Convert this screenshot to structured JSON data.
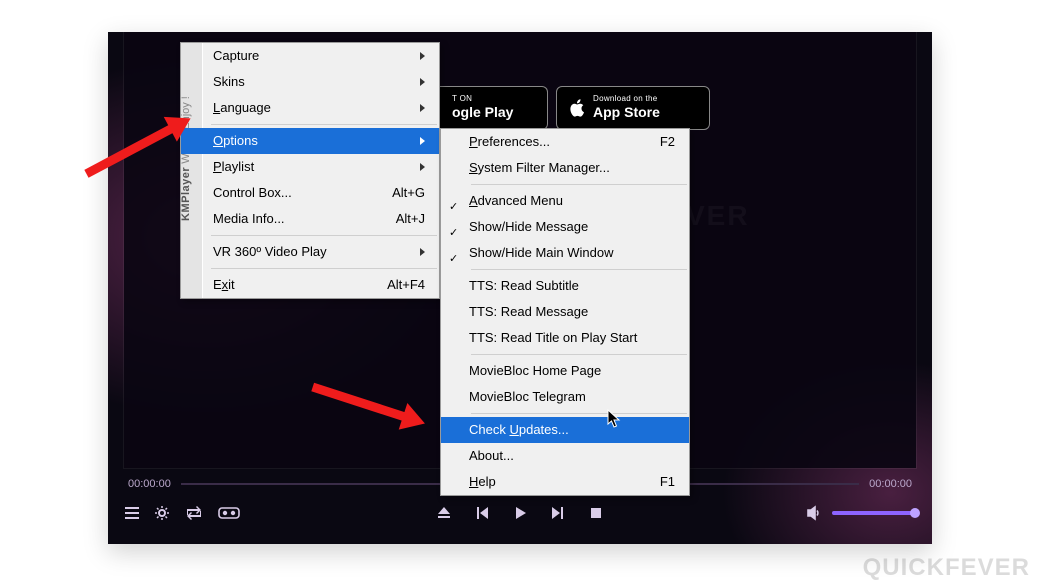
{
  "app": {
    "brand": "KMPlayer",
    "tagline": "We All Enjoy !",
    "watermark": "QUICKFEVER"
  },
  "store": {
    "google": {
      "small": "T ON",
      "big": "ogle Play"
    },
    "apple": {
      "small": "Download on the",
      "big": "App Store"
    }
  },
  "time": {
    "left": "00:00:00",
    "right": "00:00:00"
  },
  "menu1": {
    "items": [
      {
        "label": "Capture",
        "submenu": true
      },
      {
        "label": "Skins",
        "submenu": true
      },
      {
        "label": "Language",
        "submenu": true,
        "ul": 0
      },
      {
        "sep": true
      },
      {
        "label": "Options",
        "submenu": true,
        "ul": 0,
        "highlight": true
      },
      {
        "label": "Playlist",
        "submenu": true,
        "ul": 0
      },
      {
        "label": "Control Box...",
        "shortcut": "Alt+G"
      },
      {
        "label": "Media Info...",
        "shortcut": "Alt+J"
      },
      {
        "sep": true
      },
      {
        "label": "VR 360º Video Play",
        "submenu": true
      },
      {
        "sep": true
      },
      {
        "label": "Exit",
        "shortcut": "Alt+F4",
        "ul": 1
      }
    ]
  },
  "menu2": {
    "items": [
      {
        "label": "Preferences...",
        "shortcut": "F2",
        "ul": 0
      },
      {
        "label": "System Filter Manager...",
        "ul": 0
      },
      {
        "sep": true
      },
      {
        "label": "Advanced Menu",
        "check": true,
        "ul": 0
      },
      {
        "label": "Show/Hide Message",
        "check": true
      },
      {
        "label": "Show/Hide Main Window",
        "check": true
      },
      {
        "sep": true
      },
      {
        "label": "TTS: Read Subtitle"
      },
      {
        "label": "TTS: Read Message"
      },
      {
        "label": "TTS: Read Title on Play Start"
      },
      {
        "sep": true
      },
      {
        "label": "MovieBloc Home Page"
      },
      {
        "label": "MovieBloc Telegram"
      },
      {
        "sep": true
      },
      {
        "label": "Check Updates...",
        "ul": 6,
        "highlight": true
      },
      {
        "label": "About..."
      },
      {
        "label": "Help",
        "shortcut": "F1",
        "ul": 0
      }
    ]
  }
}
